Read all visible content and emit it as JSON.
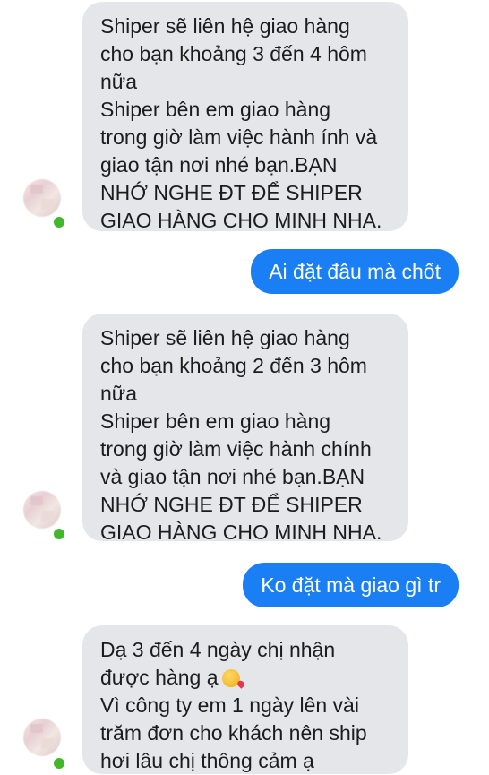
{
  "conversation": {
    "messages": [
      {
        "side": "in",
        "lines": [
          "Shiper sẽ liên hệ giao hàng",
          "cho bạn khoảng 3 đến 4  hôm",
          "nữa",
          "Shiper bên em giao hàng",
          "trong giờ làm việc hành ính và",
          "giao tận nơi nhé bạn.BẠN",
          "NHỚ NGHE ĐT ĐỂ SHIPER",
          "GIAO HÀNG CHO MINH NHA."
        ]
      },
      {
        "side": "out",
        "text": "Ai đặt đâu mà chốt"
      },
      {
        "side": "in",
        "lines": [
          "Shiper sẽ liên hệ giao hàng",
          "cho bạn khoảng 2 đến 3 hôm",
          "nữa",
          "Shiper bên em giao hàng",
          "trong giờ làm việc hành chính",
          "và giao tận nơi nhé bạn.BẠN",
          "NHỚ NGHE ĐT ĐỂ SHIPER",
          "GIAO HÀNG CHO MINH NHA."
        ]
      },
      {
        "side": "out",
        "text": "Ko đặt mà giao gì tr"
      },
      {
        "side": "in",
        "lines": [
          "Dạ 3 đến 4 ngày chị nhận",
          "được hàng ạ",
          "Vì công ty em 1 ngày lên vài",
          "trăm đơn cho khách nên ship",
          "hơi lâu chị thông cảm ạ"
        ],
        "emoji": "kiss-emoji"
      }
    ]
  },
  "colors": {
    "incoming_bubble": "#e4e6ea",
    "outgoing_bubble": "#1a7ff5",
    "online_indicator": "#42b72a"
  }
}
